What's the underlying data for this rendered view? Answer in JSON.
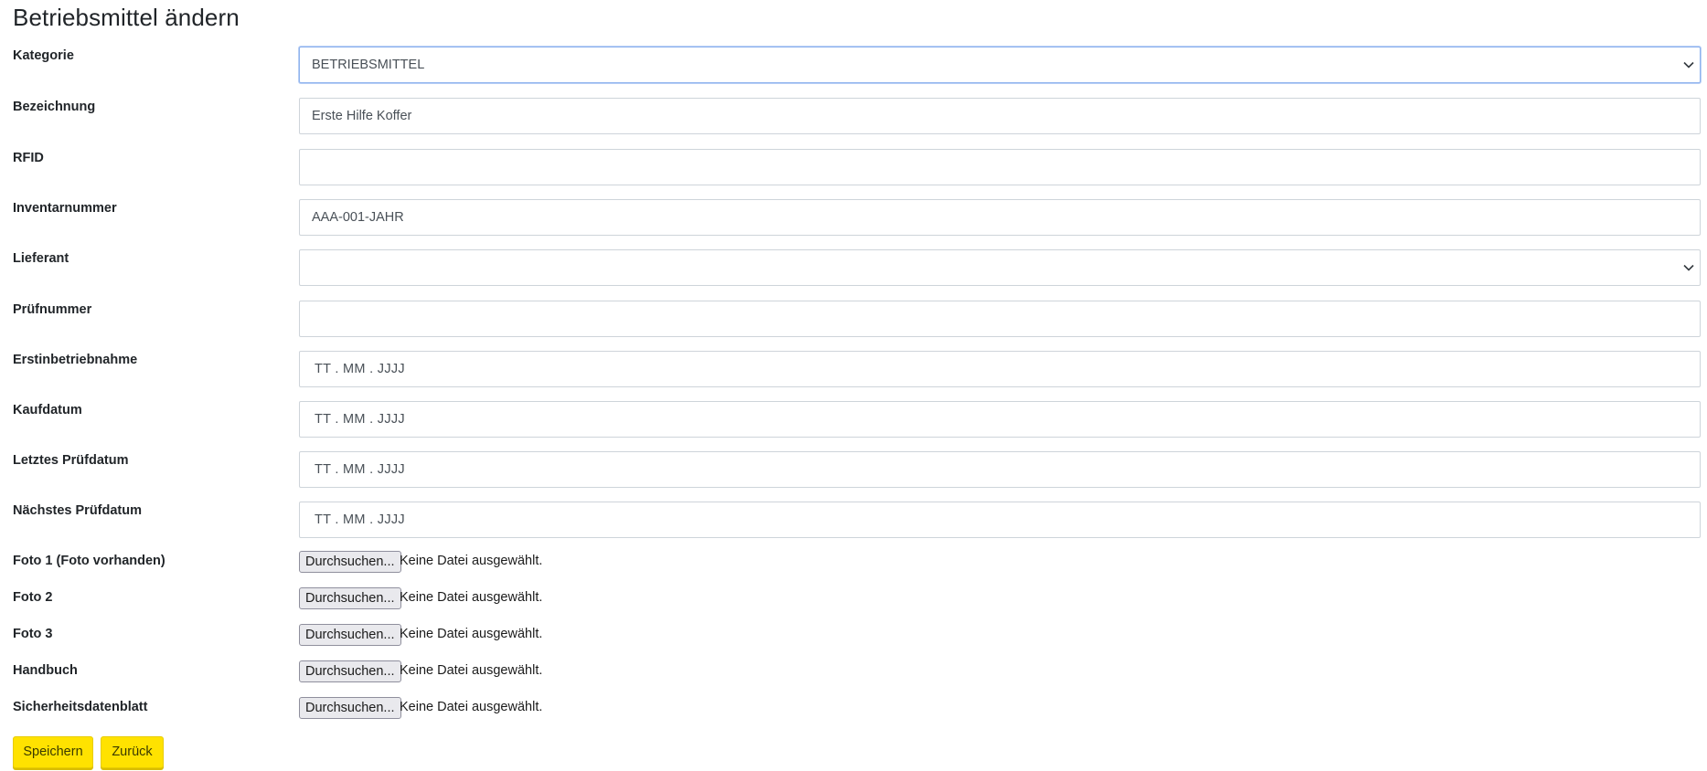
{
  "page": {
    "title": "Betriebsmittel ändern"
  },
  "form": {
    "kategorie": {
      "label": "Kategorie",
      "value": "BETRIEBSMITTEL"
    },
    "bezeichnung": {
      "label": "Bezeichnung",
      "value": "Erste Hilfe Koffer"
    },
    "rfid": {
      "label": "RFID",
      "value": ""
    },
    "inventarnummer": {
      "label": "Inventarnummer",
      "value": "AAA-001-JAHR"
    },
    "lieferant": {
      "label": "Lieferant",
      "value": ""
    },
    "pruefnummer": {
      "label": "Prüfnummer",
      "value": ""
    },
    "erstinbetriebnahme": {
      "label": "Erstinbetriebnahme",
      "placeholder": "TT . MM . JJJJ"
    },
    "kaufdatum": {
      "label": "Kaufdatum",
      "placeholder": "TT . MM . JJJJ"
    },
    "letztes_pruefdatum": {
      "label": "Letztes Prüfdatum",
      "placeholder": "TT . MM . JJJJ"
    },
    "naechstes_pruefdatum": {
      "label": "Nächstes Prüfdatum",
      "placeholder": "TT . MM . JJJJ"
    }
  },
  "files": [
    {
      "label": "Foto 1 (Foto vorhanden)",
      "button": "Durchsuchen...",
      "status": "Keine Datei ausgewählt."
    },
    {
      "label": "Foto 2",
      "button": "Durchsuchen...",
      "status": "Keine Datei ausgewählt."
    },
    {
      "label": "Foto 3",
      "button": "Durchsuchen...",
      "status": "Keine Datei ausgewählt."
    },
    {
      "label": "Handbuch",
      "button": "Durchsuchen...",
      "status": "Keine Datei ausgewählt."
    },
    {
      "label": "Sicherheitsdatenblatt",
      "button": "Durchsuchen...",
      "status": "Keine Datei ausgewählt."
    }
  ],
  "actions": {
    "save_label": "Speichern",
    "back_label": "Zurück"
  },
  "colors": {
    "button_bg": "#ffe200",
    "focus_border": "#8fb3ee",
    "input_border": "#ced4da"
  },
  "icons": {
    "select_indicator": "chevron-down-icon"
  }
}
